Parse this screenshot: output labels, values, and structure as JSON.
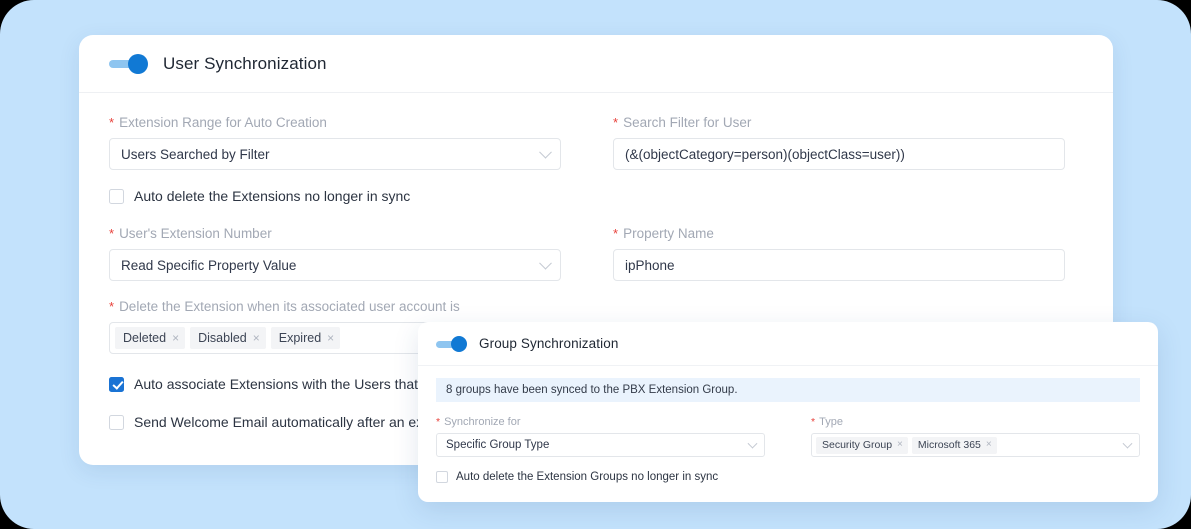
{
  "page": {
    "background_color": "#c3e2fc"
  },
  "user_sync_card": {
    "toggle": {
      "name": "user-synchronization-toggle",
      "state": "on",
      "accent": "#1179d4"
    },
    "title": "User Synchronization",
    "fields": {
      "extension_range": {
        "label": "Extension Range for Auto Creation",
        "required": true,
        "value": "Users Searched by Filter",
        "type": "select"
      },
      "search_filter": {
        "label": "Search Filter for User",
        "required": true,
        "value": "(&(objectCategory=person)(objectClass=user))",
        "type": "text"
      },
      "auto_delete_extensions": {
        "label": "Auto delete the Extensions no longer in sync",
        "checked": false
      },
      "user_extension_number": {
        "label": "User's Extension Number",
        "required": true,
        "value": "Read Specific Property Value",
        "type": "select"
      },
      "property_name": {
        "label": "Property Name",
        "required": true,
        "value": "ipPhone",
        "type": "text"
      },
      "delete_extension_when": {
        "label": "Delete the Extension when its associated user account is",
        "required": true,
        "type": "multiselect",
        "tags": [
          "Deleted",
          "Disabled",
          "Expired"
        ],
        "tag_remove_glyph": "×"
      },
      "auto_associate": {
        "label": "Auto associate Extensions with the Users that sh",
        "checked": true
      },
      "send_welcome_email": {
        "label": "Send Welcome Email automatically after an exte",
        "checked": false
      }
    }
  },
  "group_sync_card": {
    "toggle": {
      "name": "group-synchronization-toggle",
      "state": "on",
      "accent": "#1179d4"
    },
    "title": "Group Synchronization",
    "notice": "8 groups have been synced to the PBX Extension Group.",
    "fields": {
      "synchronize_for": {
        "label": "Synchronize for",
        "required": true,
        "value": "Specific Group Type",
        "type": "select"
      },
      "type": {
        "label": "Type",
        "required": true,
        "type": "multiselect",
        "tags": [
          "Security Group",
          "Microsoft 365"
        ],
        "tag_remove_glyph": "×"
      },
      "auto_delete_groups": {
        "label": "Auto delete the Extension Groups no longer in sync",
        "checked": false
      }
    }
  }
}
